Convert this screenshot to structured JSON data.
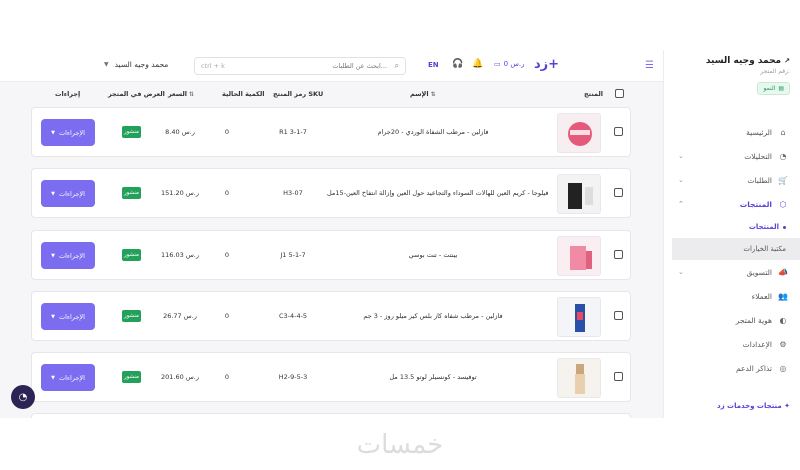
{
  "sidebar": {
    "store_name": "محمد وجيه السيد",
    "store_sub": "رقم المتجر:",
    "plan_badge": "النمو",
    "items": [
      {
        "label": "الرئيسية",
        "icon": "home-icon"
      },
      {
        "label": "التحليلات",
        "icon": "chart-icon"
      },
      {
        "label": "الطلبات",
        "icon": "cart-icon"
      },
      {
        "label": "المنتجات",
        "icon": "box-icon"
      },
      {
        "label": "التسويق",
        "icon": "megaphone-icon"
      },
      {
        "label": "العملاء",
        "icon": "users-icon"
      },
      {
        "label": "هوية المتجر",
        "icon": "palette-icon"
      },
      {
        "label": "الإعدادات",
        "icon": "gear-icon"
      },
      {
        "label": "تذاكر الدعم",
        "icon": "support-icon"
      }
    ],
    "sub_items": [
      {
        "label": "المنتجات"
      },
      {
        "label": "مكتبة الخيارات"
      }
    ],
    "footer_link": "منتجات وخدمات زد"
  },
  "topbar": {
    "logo": "زد+",
    "wallet": "0 ر.س",
    "lang": "EN",
    "search_placeholder": "ابحث عن الطلبات...",
    "search_shortcut": "ctrl + k",
    "store_selector": "محمد وجيه السيد"
  },
  "table": {
    "headers": {
      "product": "المنتج",
      "name": "الإسم",
      "sku": "رمز المنتج SKU",
      "qty": "الكمية الحالية",
      "price": "السعر",
      "display": "العرض في المتجر",
      "actions": "إجراءات"
    },
    "rows": [
      {
        "name": "فازلين - مرطب الشفاة الوردي - 20جرام",
        "sku": "R1 3-1-7",
        "qty": "0",
        "price": "8.40 ر.س",
        "status": "منشور",
        "action": "الإجراءات"
      },
      {
        "name": "فيلوجا - كريم العين للهالات السوداء والتجاعيد حول العين وإزالة انتفاخ العين-15مل",
        "sku": "H3-07",
        "qty": "0",
        "price": "151.20 ر.س",
        "status": "منشور",
        "action": "الإجراءات"
      },
      {
        "name": "بينتت - تنت بوسي",
        "sku": "J1 5-1-7",
        "qty": "0",
        "price": "116.03 ر.س",
        "status": "منشور",
        "action": "الإجراءات"
      },
      {
        "name": "فازلين - مرطب شفاه كاز بلس كير ميلو روز - 3 جم",
        "sku": "C3-4-4-5",
        "qty": "0",
        "price": "26.77 ر.س",
        "status": "منشور",
        "action": "الإجراءات"
      },
      {
        "name": "توفيسد - كونسيلر لوتو 13.5 مل",
        "sku": "H2-9-5-3",
        "qty": "0",
        "price": "201.60 ر.س",
        "status": "منشور",
        "action": "الإجراءات"
      }
    ]
  },
  "watermark": "خمسات",
  "colors": {
    "accent": "#7b6cf0",
    "brand": "#5b3fd8",
    "published": "#23a15b"
  }
}
